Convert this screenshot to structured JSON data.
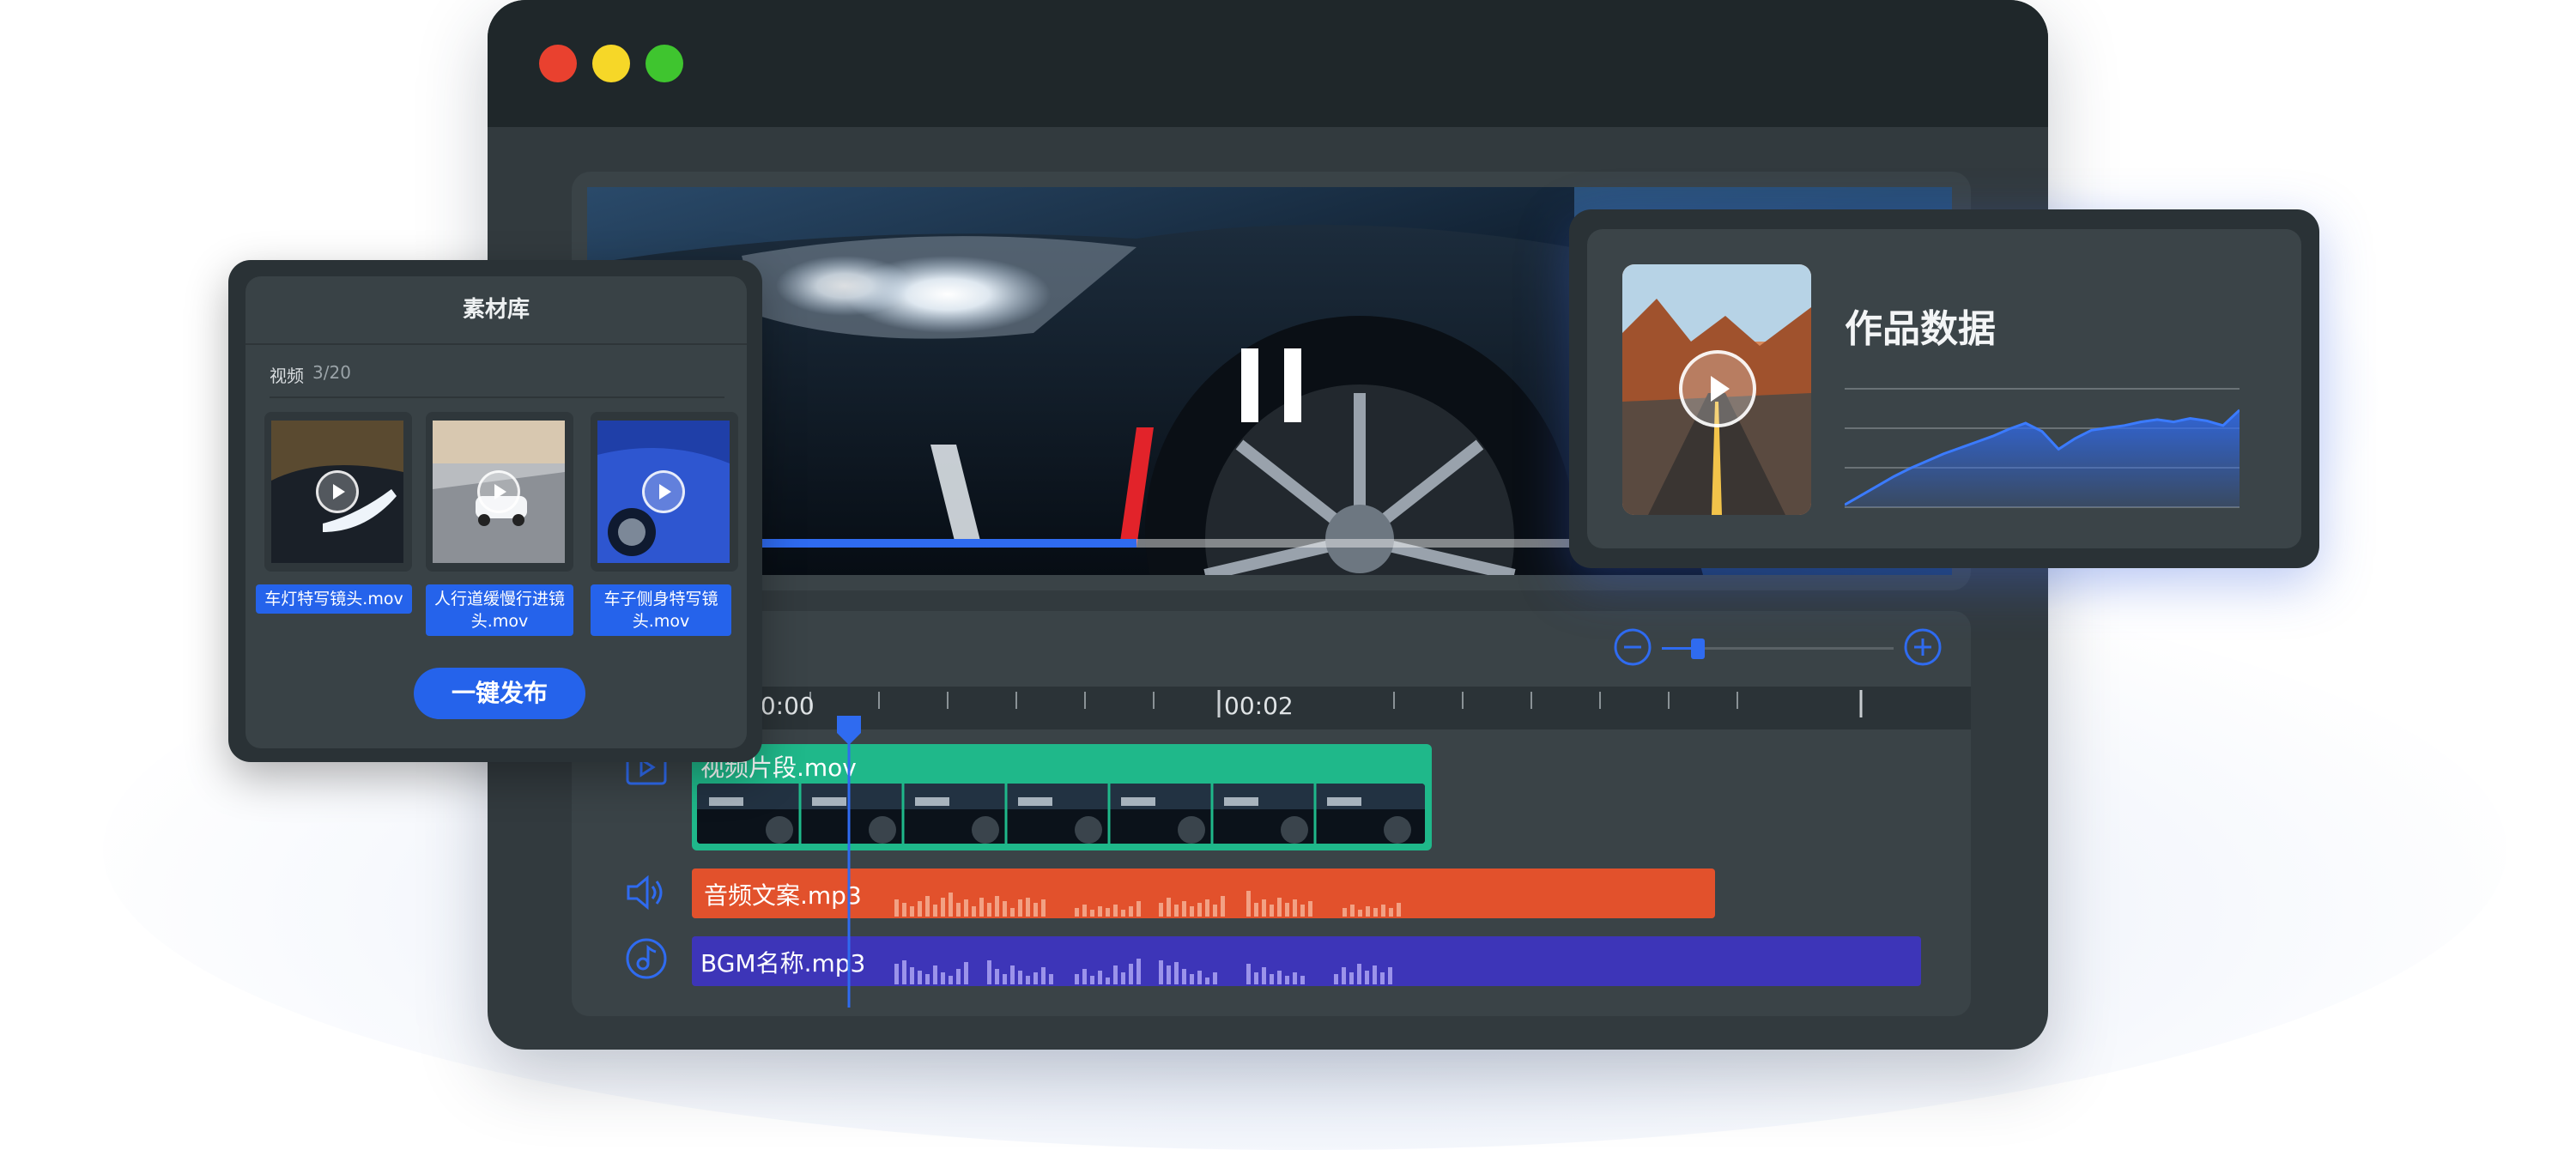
{
  "library": {
    "title": "素材库",
    "tab_label": "视频",
    "count": "3/20",
    "items": [
      {
        "name": "车灯特写镜头.mov"
      },
      {
        "name": "人行道缓慢行进镜头.mov"
      },
      {
        "name": "车子侧身特写镜头.mov"
      }
    ],
    "publish_label": "一键发布"
  },
  "data_panel": {
    "title": "作品数据"
  },
  "timeline": {
    "ruler_start": "00:00",
    "ruler_mark": "00:02",
    "tracks": [
      {
        "label": "视频片段.mov",
        "type": "video",
        "color": "#1fb88a"
      },
      {
        "label": "音频文案.mp3",
        "type": "voice",
        "color": "#e2512c"
      },
      {
        "label": "BGM名称.mp3",
        "type": "music",
        "color": "#3d35b8"
      }
    ]
  },
  "colors": {
    "accent": "#2563eb",
    "window_bg": "#323a3e",
    "titlebar_bg": "#1f272a",
    "traffic_red": "#e9412f",
    "traffic_yellow": "#f6d728",
    "traffic_green": "#3fc52f"
  },
  "icons": [
    "play-icon",
    "pause-icon",
    "zoom-out-icon",
    "zoom-in-icon",
    "video-track-icon",
    "speaker-icon",
    "music-note-icon"
  ],
  "chart_data": {
    "type": "area",
    "title": "",
    "xlabel": "",
    "ylabel": "",
    "x": [
      0,
      1,
      2,
      3,
      4,
      5,
      6,
      7,
      8,
      9,
      10,
      11,
      12,
      13,
      14,
      15,
      16,
      17,
      18,
      19,
      20,
      21,
      22,
      23,
      24
    ],
    "values": [
      2,
      10,
      18,
      26,
      33,
      39,
      45,
      50,
      55,
      60,
      66,
      71,
      64,
      49,
      58,
      65,
      67,
      69,
      72,
      74,
      72,
      75,
      73,
      69,
      82
    ],
    "ylim": [
      0,
      100
    ],
    "grid": true
  }
}
